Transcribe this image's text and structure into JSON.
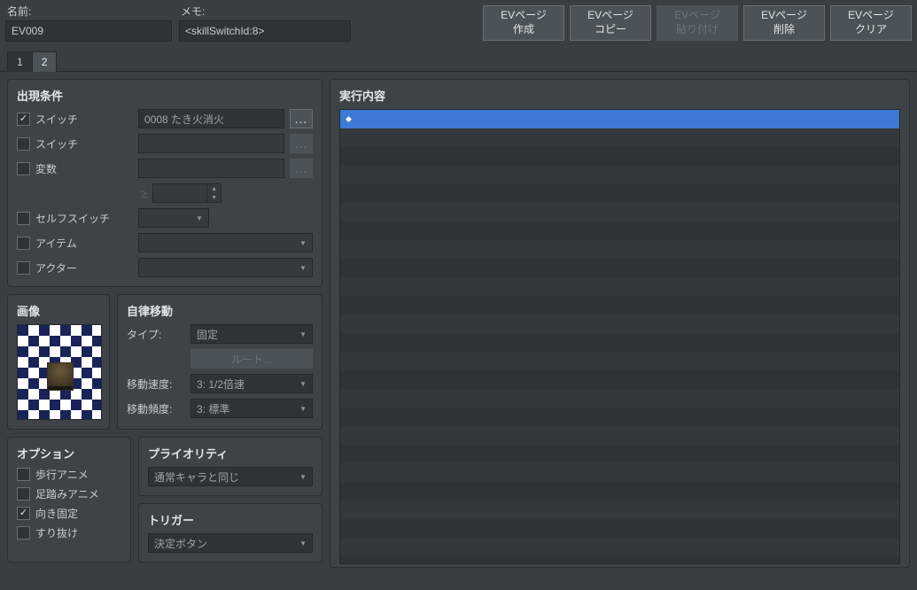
{
  "header": {
    "name_label": "名前:",
    "name_value": "EV009",
    "memo_label": "メモ:",
    "memo_value": "<skillSwitchId:8>"
  },
  "toolbar": {
    "create": {
      "l1": "EVページ",
      "l2": "作成"
    },
    "copy": {
      "l1": "EVページ",
      "l2": "コピー"
    },
    "paste": {
      "l1": "EVページ",
      "l2": "貼り付け"
    },
    "delete": {
      "l1": "EVページ",
      "l2": "削除"
    },
    "clear": {
      "l1": "EVページ",
      "l2": "クリア"
    }
  },
  "tabs": [
    "1",
    "2"
  ],
  "active_tab": 1,
  "conditions": {
    "title": "出現条件",
    "switch1": {
      "label": "スイッチ",
      "checked": true,
      "value": "0008 たき火消火"
    },
    "switch2": {
      "label": "スイッチ",
      "checked": false,
      "value": ""
    },
    "variable": {
      "label": "変数",
      "checked": false,
      "value": ""
    },
    "gte_label": "≥",
    "self_switch": {
      "label": "セルフスイッチ",
      "checked": false,
      "value": ""
    },
    "item": {
      "label": "アイテム",
      "checked": false,
      "value": ""
    },
    "actor": {
      "label": "アクター",
      "checked": false,
      "value": ""
    }
  },
  "image": {
    "title": "画像"
  },
  "autonomous": {
    "title": "自律移動",
    "type_label": "タイプ:",
    "type_value": "固定",
    "route_btn": "ルート...",
    "speed_label": "移動速度:",
    "speed_value": "3: 1/2倍速",
    "freq_label": "移動頻度:",
    "freq_value": "3: 標準"
  },
  "options": {
    "title": "オプション",
    "walk_anim": {
      "label": "歩行アニメ",
      "checked": false
    },
    "step_anim": {
      "label": "足踏みアニメ",
      "checked": false
    },
    "dir_fix": {
      "label": "向き固定",
      "checked": true
    },
    "through": {
      "label": "すり抜け",
      "checked": false
    }
  },
  "priority": {
    "title": "プライオリティ",
    "value": "通常キャラと同じ"
  },
  "trigger": {
    "title": "トリガー",
    "value": "決定ボタン"
  },
  "exec": {
    "title": "実行内容",
    "diamond": "◆"
  }
}
